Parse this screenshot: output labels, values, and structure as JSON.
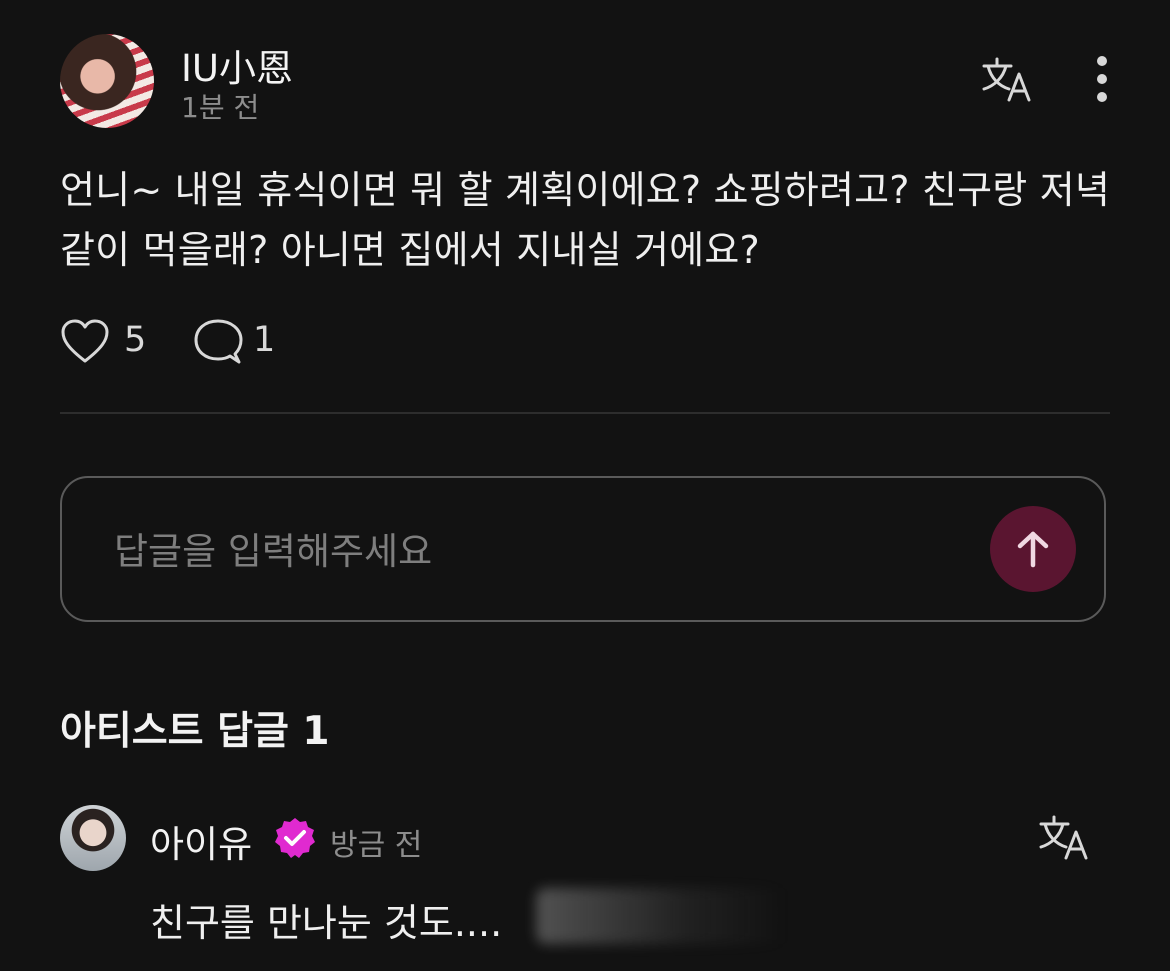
{
  "post": {
    "author": "IU小恩",
    "time": "1분 전",
    "body": "언니~ 내일 휴식이면 뭐 할 계획이에요? 쇼핑하려고? 친구랑 저녁 같이 먹을래? 아니면 집에서 지내실 거에요?",
    "likes": "5",
    "comments": "1",
    "icons": [
      "avatar",
      "translate-icon",
      "more-icon",
      "heart-icon",
      "comment-icon"
    ]
  },
  "reply_box": {
    "placeholder": "답글을 입력해주세요",
    "send_icon": "arrow-up-icon",
    "send_color": "#5a1530"
  },
  "artist_section": {
    "title": "아티스트 답글 1",
    "reply": {
      "author": "아이유",
      "badge_icon": "verified-badge-icon",
      "badge_color": "#e02ad0",
      "time": "방금 전",
      "text": "친구를 만나눈 것도...."
    }
  }
}
